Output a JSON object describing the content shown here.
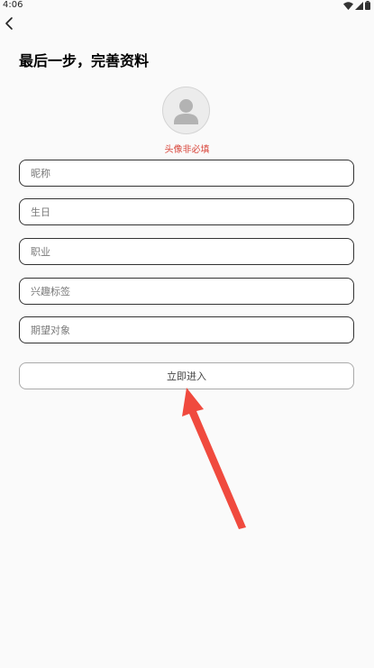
{
  "status_bar": {
    "time": "4:06"
  },
  "page": {
    "title": "最后一步，完善资料"
  },
  "avatar": {
    "hint": "头像非必填"
  },
  "form": {
    "nickname_placeholder": "昵称",
    "birthday_placeholder": "生日",
    "occupation_placeholder": "职业",
    "interests_placeholder": "兴趣标签",
    "expectation_placeholder": "期望对象"
  },
  "submit": {
    "label": "立即进入"
  },
  "colors": {
    "hint_red": "#d9473c",
    "arrow_red": "#f04a3e",
    "border_dark": "#333333"
  }
}
